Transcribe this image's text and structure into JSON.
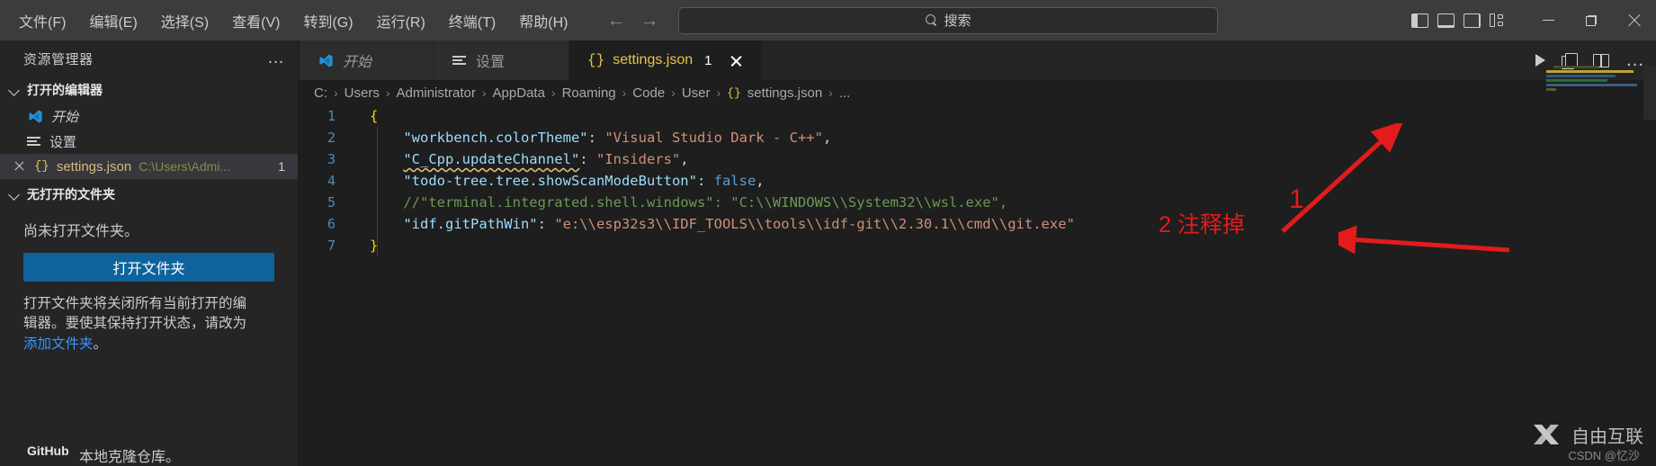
{
  "titlebar": {
    "menus": [
      "文件(F)",
      "编辑(E)",
      "选择(S)",
      "查看(V)",
      "转到(G)",
      "运行(R)",
      "终端(T)",
      "帮助(H)"
    ],
    "nav_back": "←",
    "nav_forward": "→",
    "search_placeholder": "搜索",
    "layout_icons": [
      "toggle-primary-sidebar",
      "toggle-panel",
      "toggle-secondary-sidebar",
      "customize-layout"
    ],
    "window_controls": [
      "minimize",
      "restore",
      "close"
    ]
  },
  "sidebar": {
    "title": "资源管理器",
    "more_actions": "…",
    "sections": [
      {
        "label": "打开的编辑器"
      },
      {
        "label": "无打开的文件夹"
      },
      {
        "label": "GitHub"
      }
    ],
    "open_editors": [
      {
        "label": "开始",
        "icon": "vscode-logo-icon",
        "italic": true
      },
      {
        "label": "设置",
        "icon": "settings-lines-icon",
        "italic": false
      },
      {
        "label": "settings.json",
        "path": "C:\\Users\\Admi...",
        "badge": "1",
        "icon": "json-braces-icon",
        "selected": true
      }
    ],
    "no_folder_text": "尚未打开文件夹。",
    "open_folder_button": "打开文件夹",
    "explain_line1": "打开文件夹将关闭所有当前打开的编",
    "explain_line2": "辑器。要使其保持打开状态，请改为",
    "explain_link": "添加文件夹",
    "explain_period": "。",
    "clone_text": "本地克隆仓库。"
  },
  "editor": {
    "tabs": [
      {
        "label": "开始",
        "icon": "vscode-logo-icon",
        "active": false,
        "italic": true
      },
      {
        "label": "设置",
        "icon": "settings-lines-icon",
        "active": false,
        "italic": false
      },
      {
        "label": "settings.json",
        "icon": "json-braces-icon",
        "active": true,
        "badge": "1",
        "italic": false
      }
    ],
    "tab_actions": [
      "run-button",
      "split-copy-button",
      "split-editor-button",
      "more-actions-button"
    ],
    "breadcrumb": [
      "C:",
      "Users",
      "Administrator",
      "AppData",
      "Roaming",
      "Code",
      "User",
      "settings.json",
      "..."
    ],
    "breadcrumb_separator": "›",
    "breadcrumb_ellipsis": "…",
    "code_lines": [
      {
        "num": "1",
        "tokens": [
          {
            "t": "{",
            "c": "brace"
          }
        ]
      },
      {
        "num": "2",
        "tokens": [
          {
            "t": "    ",
            "c": "plain"
          },
          {
            "t": "\"workbench.colorTheme\"",
            "c": "key"
          },
          {
            "t": ": ",
            "c": "colon"
          },
          {
            "t": "\"Visual Studio Dark - C++\"",
            "c": "str"
          },
          {
            "t": ",",
            "c": "comma"
          }
        ]
      },
      {
        "num": "3",
        "tokens": [
          {
            "t": "    ",
            "c": "plain"
          },
          {
            "t": "\"C_Cpp.updateChannel\"",
            "c": "key-squiggle"
          },
          {
            "t": ": ",
            "c": "colon"
          },
          {
            "t": "\"Insiders\"",
            "c": "str"
          },
          {
            "t": ",",
            "c": "comma"
          }
        ]
      },
      {
        "num": "4",
        "tokens": [
          {
            "t": "    ",
            "c": "plain"
          },
          {
            "t": "\"todo-tree.tree.showScanModeButton\"",
            "c": "key"
          },
          {
            "t": ": ",
            "c": "colon"
          },
          {
            "t": "false",
            "c": "bool"
          },
          {
            "t": ",",
            "c": "comma"
          }
        ]
      },
      {
        "num": "5",
        "tokens": [
          {
            "t": "    ",
            "c": "plain"
          },
          {
            "t": "//\"terminal.integrated.shell.windows\": \"C:\\\\WINDOWS\\\\System32\\\\wsl.exe\",",
            "c": "comment"
          }
        ]
      },
      {
        "num": "6",
        "tokens": [
          {
            "t": "    ",
            "c": "plain"
          },
          {
            "t": "\"idf.gitPathWin\"",
            "c": "key"
          },
          {
            "t": ": ",
            "c": "colon"
          },
          {
            "t": "\"e:\\\\esp32s3\\\\IDF_TOOLS\\\\tools\\\\idf-git\\\\2.30.1\\\\cmd\\\\git.exe\"",
            "c": "str"
          }
        ]
      },
      {
        "num": "7",
        "tokens": [
          {
            "t": "}",
            "c": "brace"
          }
        ]
      }
    ]
  },
  "annotations": [
    {
      "id": "1",
      "label": "1",
      "kind": "arrow-to-minimap"
    },
    {
      "id": "2",
      "label": "2 注释掉",
      "kind": "arrow-to-line5"
    }
  ],
  "watermark": {
    "brand": "自由互联",
    "credit": "CSDN @忆沙"
  },
  "colors": {
    "accent_blue": "#0e639c",
    "annotation_red": "#e31b1b",
    "json_key": "#9cdcfe",
    "json_string": "#ce9178",
    "json_comment": "#6a9955",
    "json_bool": "#569cd6",
    "brace_yellow": "#ffd700",
    "titlebar_bg": "#3c3c3c",
    "sidebar_bg": "#252526",
    "editor_bg": "#1e1e1e"
  }
}
